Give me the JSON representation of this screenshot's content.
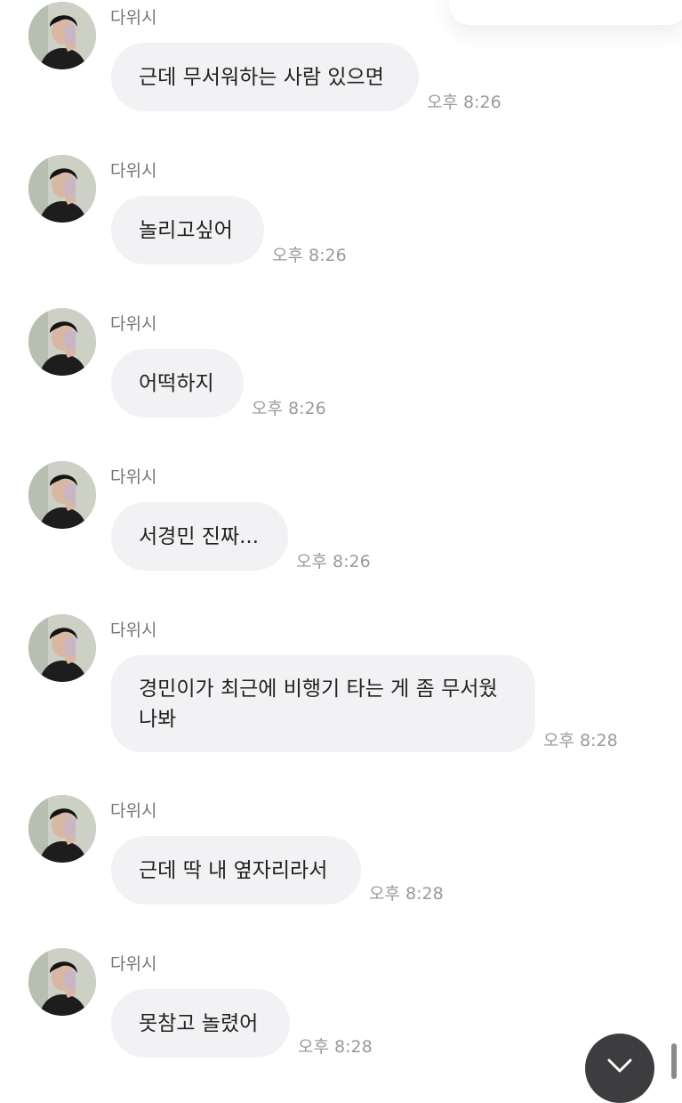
{
  "chat": {
    "messages": [
      {
        "sender": "다위시",
        "text": "근데 무서워하는 사람 있으면",
        "time": "오후 8:26"
      },
      {
        "sender": "다위시",
        "text": "놀리고싶어",
        "time": "오후 8:26"
      },
      {
        "sender": "다위시",
        "text": "어떡하지",
        "time": "오후 8:26"
      },
      {
        "sender": "다위시",
        "text": "서경민 진짜...",
        "time": "오후 8:26"
      },
      {
        "sender": "다위시",
        "text_line1": "경민이가 최근에 비행기 타는 게 좀 무서웠",
        "text_line2": "나봐",
        "time": "오후 8:28"
      },
      {
        "sender": "다위시",
        "text": "근데 딱 내 옆자리라서",
        "time": "오후 8:28"
      },
      {
        "sender": "다위시",
        "text": "못참고 놀렸어",
        "time": "오후 8:28"
      }
    ]
  },
  "colors": {
    "bubble_bg": "#f2f2f4",
    "sender_text": "#767676",
    "time_text": "#9a9a9a",
    "scroll_button": "#3d3d40"
  },
  "icons": {
    "scroll_down": "chevron-down-icon",
    "avatar": "profile-photo"
  }
}
